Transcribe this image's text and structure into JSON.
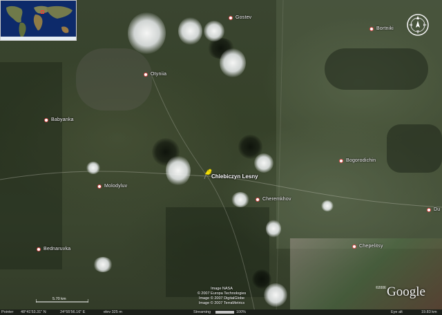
{
  "places": [
    {
      "name": "Gostev"
    },
    {
      "name": "Bortniki"
    },
    {
      "name": "Otyniia"
    },
    {
      "name": "Babyanka"
    },
    {
      "name": "Bogorodichin"
    },
    {
      "name": "Molodyluv"
    },
    {
      "name": "Cheremkhov"
    },
    {
      "name": "Du"
    },
    {
      "name": "Bednaruvka"
    },
    {
      "name": "Chepelitsy"
    }
  ],
  "pin": {
    "label": "Chlebiczyn Lesny"
  },
  "credits": {
    "line1": "Image NASA",
    "line2": "© 2007 Europa Technologies",
    "line3": "Image © 2007 DigitalGlobe",
    "line4": "Image © 2007 TerraMetrics"
  },
  "logo": {
    "text": "Google",
    "year": "©2006"
  },
  "scale": {
    "label": "5.70 km"
  },
  "status": {
    "pointer_label": "Pointer",
    "latitude": "48°41'53.31\" N",
    "longitude": "24°55'56.16\" E",
    "elevation": "elev 325 m",
    "streaming_label": "Streaming",
    "streaming_percent": "100%",
    "streaming_fraction": 1.0,
    "eye_label": "Eye alt",
    "eye_alt": "19.83 km"
  },
  "colors": {
    "place_dot_border": "#d44444",
    "pin_yellow": "#f5e20a",
    "water": "#0d2a6a"
  },
  "icons": {
    "pin": "pushpin-icon",
    "compass": "compass-icon",
    "overview": "world-overview-map"
  }
}
